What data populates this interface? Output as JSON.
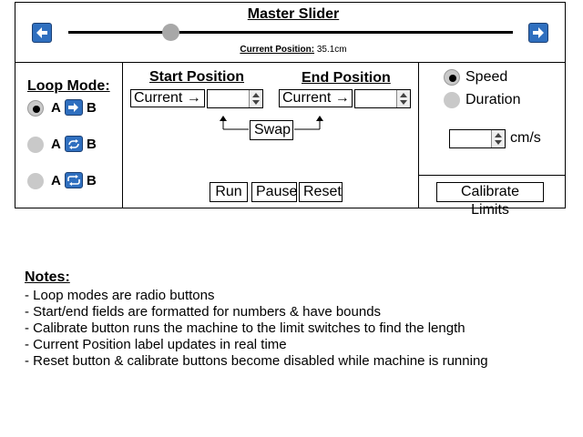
{
  "header": {
    "title": "Master Slider",
    "position_label": "Current Position:",
    "position_value": "35.1cm",
    "slider_fraction": 0.23,
    "left_icon": "arrow-left-icon",
    "right_icon": "arrow-right-icon"
  },
  "loop": {
    "heading": "Loop Mode:",
    "options": [
      {
        "a": "A",
        "b": "B",
        "icon": "arrow-right-icon",
        "selected": true
      },
      {
        "a": "A",
        "b": "B",
        "icon": "loop-icon",
        "selected": false
      },
      {
        "a": "A",
        "b": "B",
        "icon": "repeat-icon",
        "selected": false
      }
    ]
  },
  "positions": {
    "start_heading": "Start Position",
    "end_heading": "End Position",
    "start_field": "Current →",
    "end_field": "Current →",
    "start_value": "",
    "end_value": "",
    "swap_label": "Swap"
  },
  "controls": {
    "run_label": "Run",
    "pause_label": "Pause",
    "reset_label": "Reset"
  },
  "speed": {
    "option_speed": "Speed",
    "option_duration": "Duration",
    "selected": "Speed",
    "value": "",
    "unit": "cm/s",
    "calibrate_label": "Calibrate Limits"
  },
  "notes": {
    "heading": "Notes:",
    "items": [
      "- Loop modes are radio buttons",
      "- Start/end fields are formatted for numbers & have bounds",
      "- Calibrate button runs the machine to the limit switches to find the length",
      "- Current Position label updates in real time",
      "- Reset button & calibrate buttons become disabled while machine is running"
    ]
  },
  "colors": {
    "accent": "#2f6fbf",
    "radio_fill": "#c9c9c9"
  }
}
